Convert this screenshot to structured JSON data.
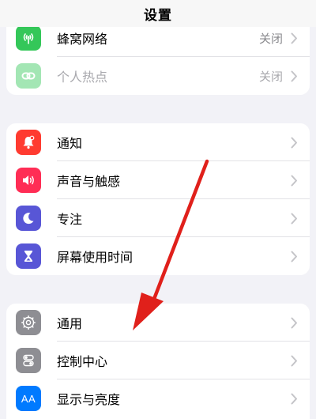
{
  "nav": {
    "title": "设置"
  },
  "network_group": {
    "rows": [
      {
        "label": "蜂窝网络",
        "value": "关闭",
        "icon": "antenna-icon",
        "color": "#34c759"
      },
      {
        "label": "个人热点",
        "value": "关闭",
        "icon": "link-icon",
        "color": "#34c759"
      }
    ]
  },
  "notify_group": {
    "rows": [
      {
        "label": "通知",
        "icon": "bell-icon",
        "color": "#ff3b30"
      },
      {
        "label": "声音与触感",
        "icon": "speaker-icon",
        "color": "#ff2d55"
      },
      {
        "label": "专注",
        "icon": "moon-icon",
        "color": "#5856d6"
      },
      {
        "label": "屏幕使用时间",
        "icon": "hourglass-icon",
        "color": "#5856d6"
      }
    ]
  },
  "general_group": {
    "rows": [
      {
        "label": "通用",
        "icon": "gear-icon",
        "color": "#8e8e93"
      },
      {
        "label": "控制中心",
        "icon": "toggles-icon",
        "color": "#8e8e93"
      },
      {
        "label": "显示与亮度",
        "icon": "text-size-icon",
        "color": "#007aff",
        "icon_text": "AA"
      }
    ]
  },
  "annotation": {
    "arrow_color": "#e0201b"
  }
}
